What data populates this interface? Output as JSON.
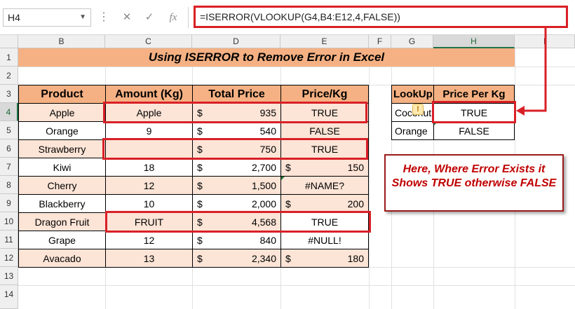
{
  "formula_bar": {
    "name_box": "H4",
    "cancel_icon": "✕",
    "enter_icon": "✓",
    "fx_icon": "fx",
    "formula": "=ISERROR(VLOOKUP(G4,B4:E12,4,FALSE))"
  },
  "columns": [
    "B",
    "C",
    "D",
    "E",
    "F",
    "G",
    "H",
    "I"
  ],
  "rows": [
    "1",
    "2",
    "3",
    "4",
    "5",
    "6",
    "7",
    "8",
    "9",
    "10",
    "11",
    "12",
    "13",
    "14"
  ],
  "title": "Using ISERROR to Remove Error in Excel",
  "table": {
    "headers": [
      "Product",
      "Amount (Kg)",
      "Total Price",
      "Price/Kg"
    ],
    "rows": [
      {
        "product": "Apple",
        "amount": "Apple",
        "dollar": "$",
        "total": "935",
        "price_kg": "TRUE",
        "pk_dollar": ""
      },
      {
        "product": "Orange",
        "amount": "9",
        "dollar": "$",
        "total": "540",
        "price_kg": "FALSE",
        "pk_dollar": ""
      },
      {
        "product": "Strawberry",
        "amount": "",
        "dollar": "$",
        "total": "750",
        "price_kg": "TRUE",
        "pk_dollar": ""
      },
      {
        "product": "Kiwi",
        "amount": "18",
        "dollar": "$",
        "total": "2,700",
        "price_kg": "150",
        "pk_dollar": "$"
      },
      {
        "product": "Cherry",
        "amount": "12",
        "dollar": "$",
        "total": "1,500",
        "price_kg": "#NAME?",
        "pk_dollar": ""
      },
      {
        "product": "Blackberry",
        "amount": "10",
        "dollar": "$",
        "total": "2,000",
        "price_kg": "200",
        "pk_dollar": "$"
      },
      {
        "product": "Dragon Fruit",
        "amount": "FRUIT",
        "dollar": "$",
        "total": "4,568",
        "price_kg": "TRUE",
        "pk_dollar": ""
      },
      {
        "product": "Grape",
        "amount": "12",
        "dollar": "$",
        "total": "840",
        "price_kg": "#NULL!",
        "pk_dollar": ""
      },
      {
        "product": "Avacado",
        "amount": "13",
        "dollar": "$",
        "total": "2,340",
        "price_kg": "180",
        "pk_dollar": "$"
      }
    ]
  },
  "lookup": {
    "headers": [
      "LookUp",
      "Price Per Kg"
    ],
    "rows": [
      {
        "value": "Coconut",
        "result": "TRUE"
      },
      {
        "value": "Orange",
        "result": "FALSE"
      }
    ]
  },
  "callout_text": "Here, Where Error Exists it Shows TRUE otherwise FALSE",
  "warning_icon": "!",
  "colors": {
    "header_fill": "#f5b183",
    "row_fill": "#fce4d6",
    "highlight": "#d92027",
    "callout_text": "#c00000"
  }
}
